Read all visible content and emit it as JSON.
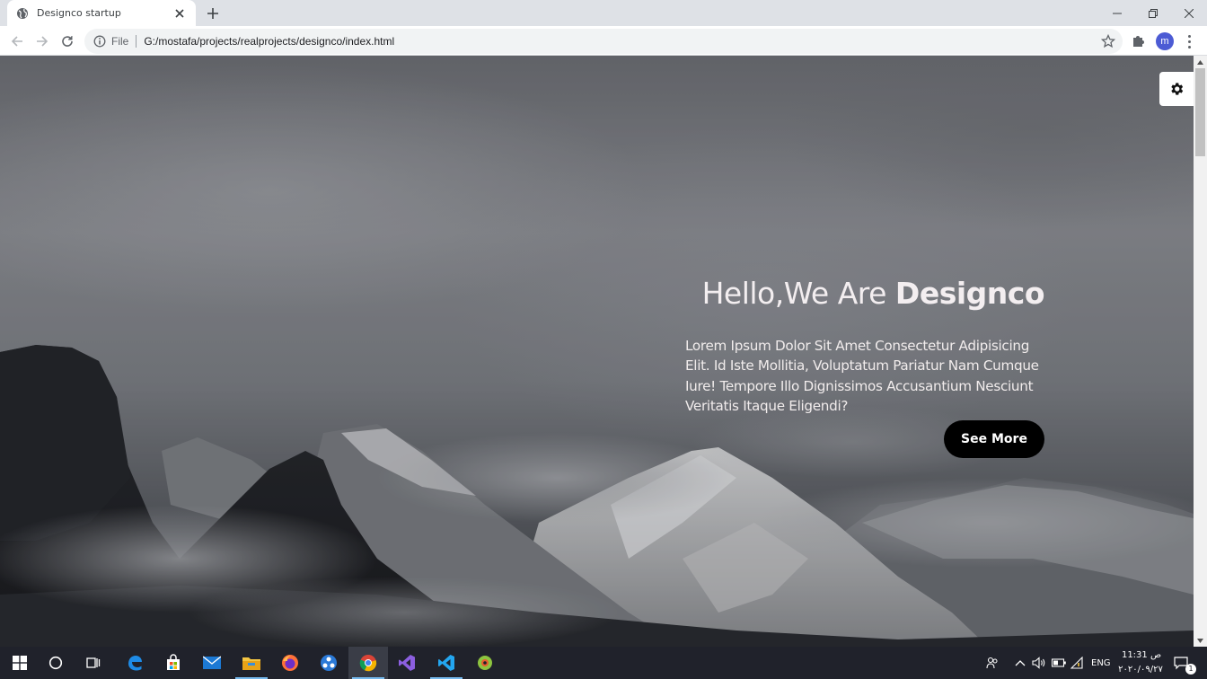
{
  "browser": {
    "tab_title": "Designco startup",
    "address_scheme": "File",
    "address_url": "G:/mostafa/projects/realprojects/designco/index.html",
    "profile_initial": "m"
  },
  "page": {
    "heading_prefix": "Hello,We Are ",
    "heading_brand": "Designco",
    "description": "Lorem Ipsum Dolor Sit Amet Consectetur Adipisicing Elit. Id Iste Mollitia, Voluptatum Pariatur Nam Cumque Iure! Tempore Illo Dignissimos Accusantium Nesciunt Veritatis Itaque Eligendi?",
    "cta_label": "See More"
  },
  "taskbar": {
    "apps": [
      "windows-start",
      "cortana",
      "task-view",
      "edge",
      "store",
      "mail",
      "file-explorer",
      "firefox",
      "davinci",
      "chrome",
      "visual-studio",
      "vscode",
      "app"
    ],
    "language": "ENG",
    "time": "11:31 ص",
    "date": "٢٠٢٠/٠٩/٢٧",
    "notifications": "1"
  },
  "colors": {
    "cta_background": "#000000",
    "heading_text": "#f3eef0",
    "taskbar": "#20222b"
  }
}
